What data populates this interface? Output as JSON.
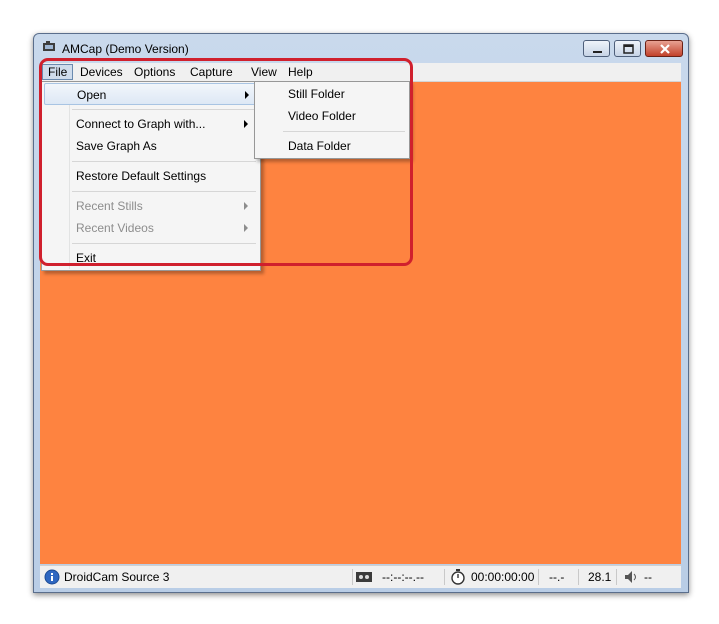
{
  "window": {
    "title": "AMCap (Demo Version)"
  },
  "menubar": [
    {
      "label": "File"
    },
    {
      "label": "Devices"
    },
    {
      "label": "Options"
    },
    {
      "label": "Capture"
    },
    {
      "label": "View"
    },
    {
      "label": "Help"
    }
  ],
  "file_menu": {
    "items": [
      {
        "label": "Open",
        "submenu": true,
        "enabled": true,
        "highlighted": true
      },
      {
        "label": "Connect to Graph with...",
        "submenu": true,
        "enabled": true
      },
      {
        "label": "Save Graph As",
        "submenu": false,
        "enabled": true
      },
      {
        "label": "Restore Default Settings",
        "submenu": false,
        "enabled": true
      },
      {
        "label": "Recent Stills",
        "submenu": true,
        "enabled": false
      },
      {
        "label": "Recent Videos",
        "submenu": true,
        "enabled": false
      },
      {
        "label": "Exit",
        "submenu": false,
        "enabled": true
      }
    ]
  },
  "open_submenu": {
    "items": [
      {
        "label": "Still Folder"
      },
      {
        "label": "Video Folder"
      },
      {
        "label": "Data Folder"
      }
    ]
  },
  "status": {
    "source": "DroidCam Source 3",
    "timecode": "--:--:--.--",
    "elapsed": "00:00:00:00",
    "value1": "--.-",
    "framerate": "28.1",
    "volume": "--"
  },
  "colors": {
    "preview_bg": "#fe8340",
    "annotation_outline": "#d0202d"
  }
}
